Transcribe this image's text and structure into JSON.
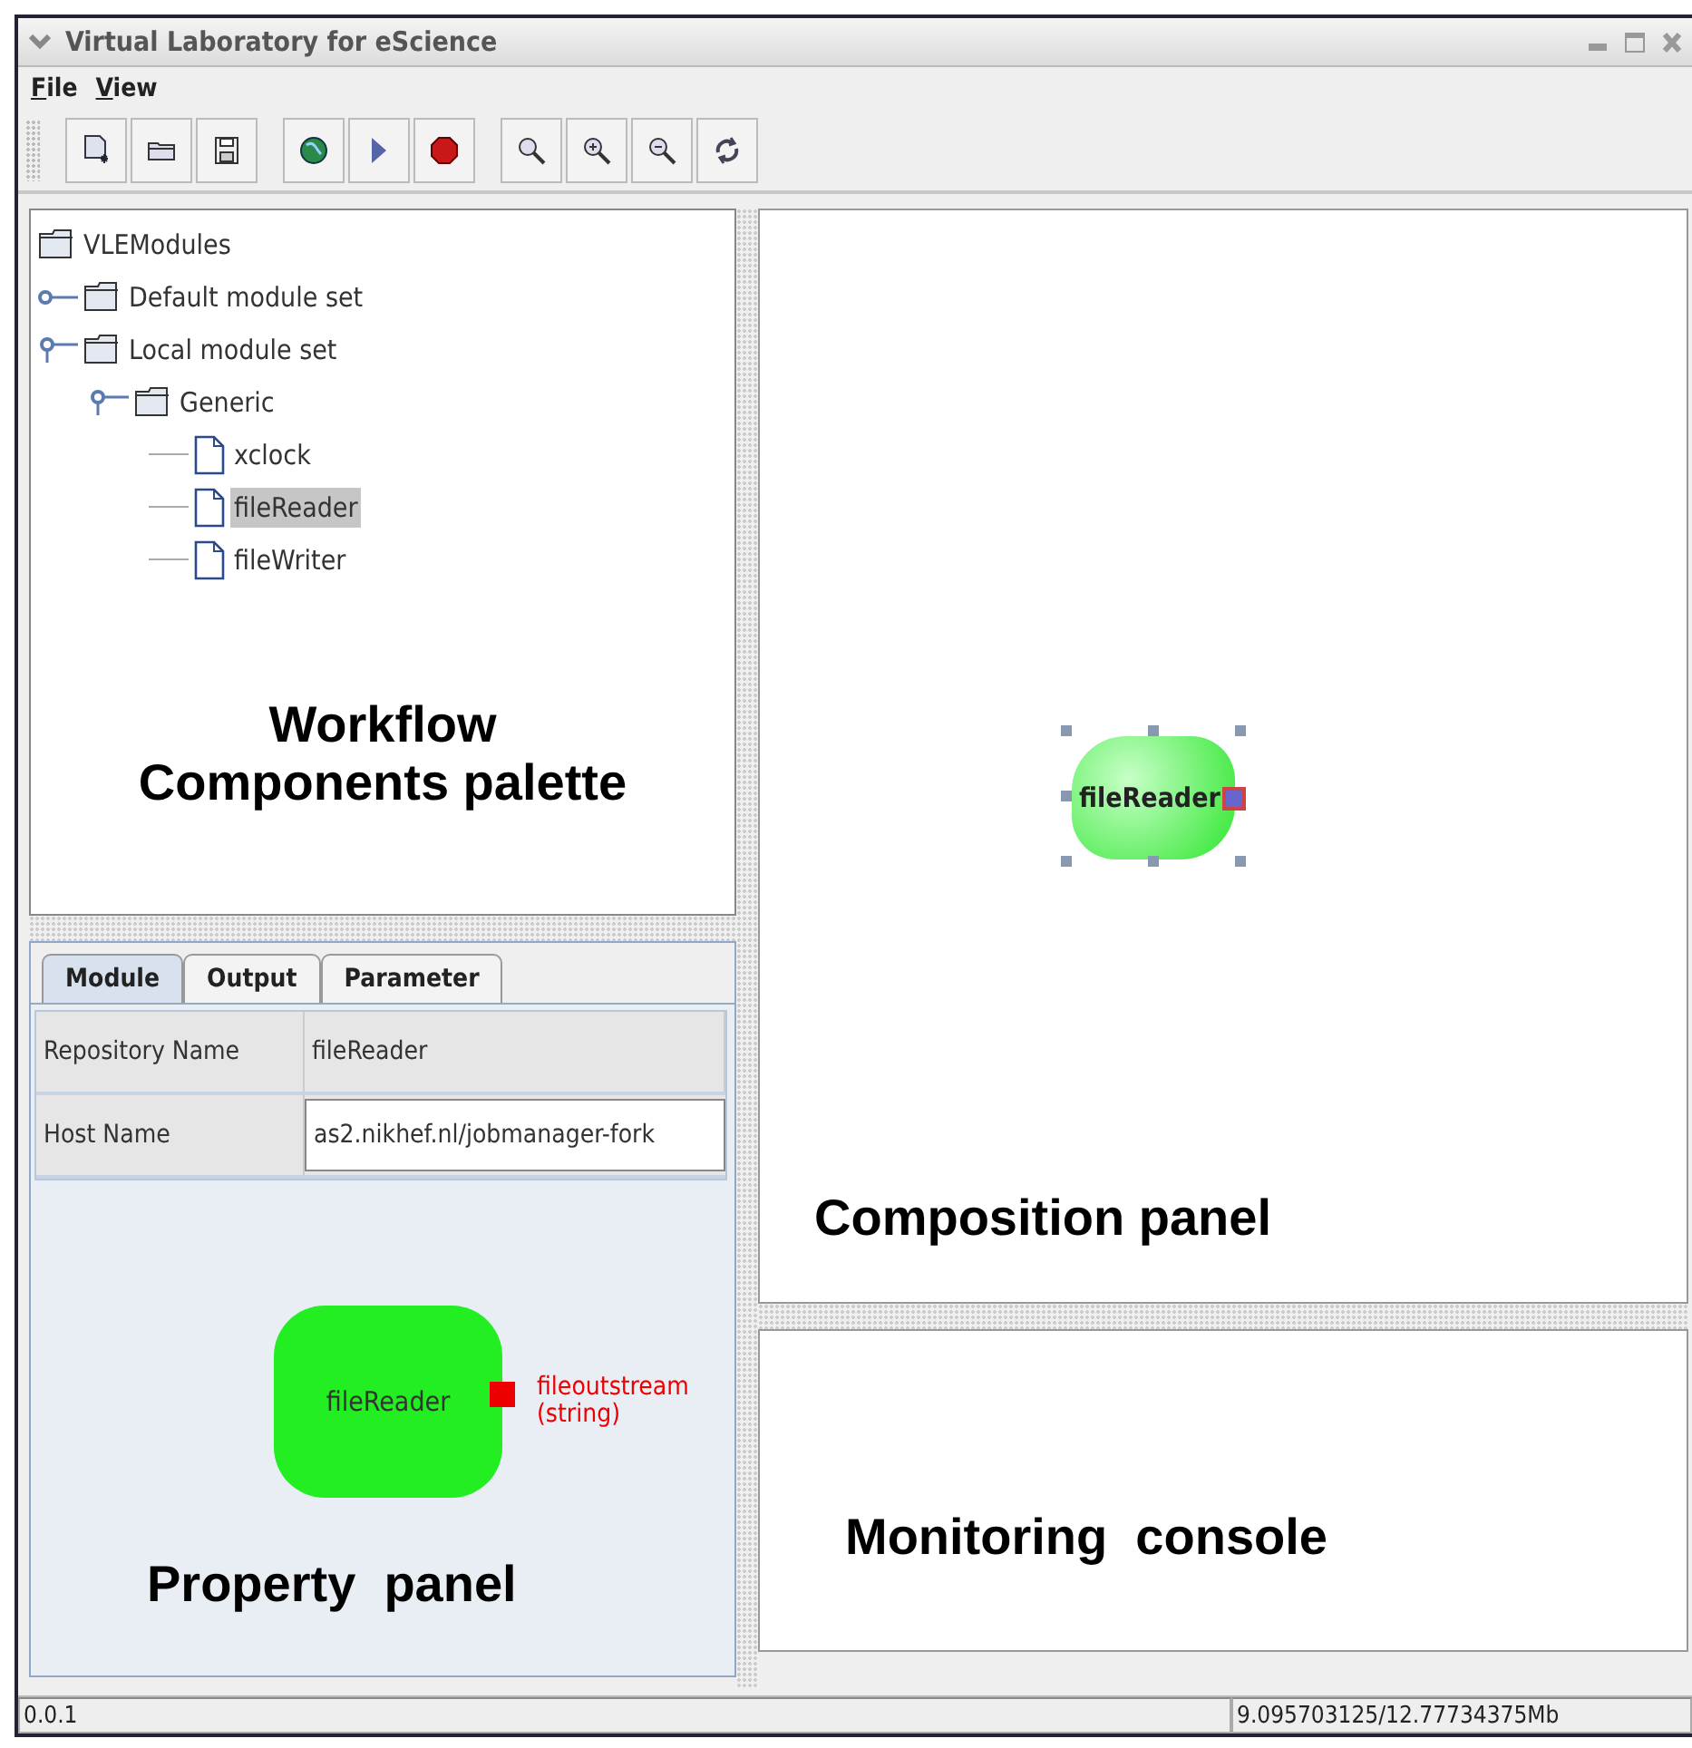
{
  "window": {
    "title": "Virtual Laboratory for eScience"
  },
  "menu": [
    {
      "label": "File"
    },
    {
      "label": "View"
    }
  ],
  "toolbar": [
    [
      {
        "kind": "new"
      },
      {
        "kind": "open"
      },
      {
        "kind": "save"
      }
    ],
    [
      {
        "kind": "globe"
      },
      {
        "kind": "run"
      },
      {
        "kind": "stop"
      }
    ],
    [
      {
        "kind": "zoom"
      },
      {
        "kind": "zoom-in"
      },
      {
        "kind": "zoom-out"
      },
      {
        "kind": "refresh"
      }
    ]
  ],
  "tree": {
    "label": "VLEModules",
    "kind": "folder",
    "selected": false,
    "children": [
      {
        "label": "Default module set",
        "kind": "folder",
        "expanded": false,
        "selected": false
      },
      {
        "label": "Local module set",
        "kind": "folder",
        "expanded": true,
        "selected": false,
        "children": [
          {
            "label": "Generic",
            "kind": "folder",
            "expanded": true,
            "selected": false,
            "children": [
              {
                "label": "xclock",
                "kind": "file",
                "selected": false
              },
              {
                "label": "fileReader",
                "kind": "file",
                "selected": true
              },
              {
                "label": "fileWriter",
                "kind": "file",
                "selected": false
              }
            ]
          }
        ]
      }
    ]
  },
  "palette_caption": "Workflow\nComponents palette",
  "property_panel": {
    "tabs": [
      {
        "label": "Module",
        "selected": true
      },
      {
        "label": "Output",
        "selected": false
      },
      {
        "label": "Parameter",
        "selected": false
      }
    ],
    "rows": [
      {
        "label": "Repository Name",
        "value": "fileReader",
        "kind": "text"
      },
      {
        "label": "Host Name",
        "value": "as2.nikhef.nl/jobmanager-fork",
        "kind": "field"
      }
    ],
    "module": {
      "name": "fileReader",
      "port_name": "fileoutstream",
      "port_type": "(string)"
    },
    "caption": "Property  panel"
  },
  "composition_panel": {
    "node": {
      "name": "fileReader",
      "selected": true
    },
    "caption": "Composition panel"
  },
  "monitoring_console": {
    "caption": "Monitoring  console"
  },
  "status_bar": {
    "version": "0.0.1",
    "memory": "9.095703125/12.77734375Mb"
  }
}
